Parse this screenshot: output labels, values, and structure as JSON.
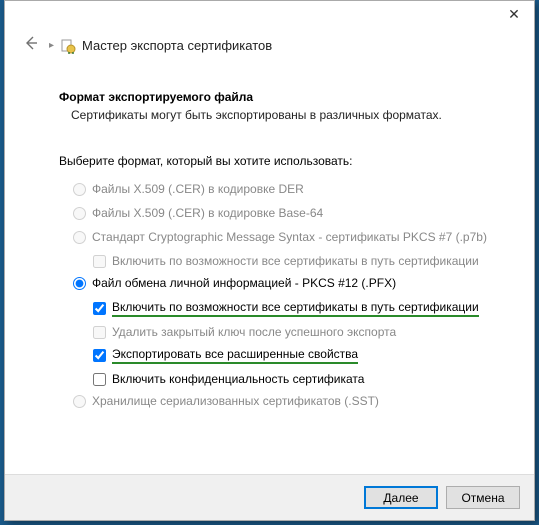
{
  "window": {
    "close_glyph": "✕"
  },
  "header": {
    "title": "Мастер экспорта сертификатов"
  },
  "section": {
    "title": "Формат экспортируемого файла",
    "subtitle": "Сертификаты могут быть экспортированы в различных форматах."
  },
  "instruction": "Выберите формат, который вы хотите использовать:",
  "options": {
    "der": "Файлы X.509 (.CER) в кодировке DER",
    "base64": "Файлы X.509 (.CER) в кодировке Base-64",
    "pkcs7": "Стандарт Cryptographic Message Syntax - сертификаты PKCS #7 (.p7b)",
    "pkcs7_sub": "Включить по возможности все сертификаты в путь сертификации",
    "pfx": "Файл обмена личной информацией - PKCS #12 (.PFX)",
    "pfx_chain": "Включить по возможности все сертификаты в путь сертификации",
    "pfx_delete": "Удалить закрытый ключ после успешного экспорта",
    "pfx_extprops": "Экспортировать все расширенные свойства",
    "pfx_privacy": "Включить конфиденциальность сертификата",
    "sst": "Хранилище сериализованных сертификатов (.SST)"
  },
  "footer": {
    "next": "Далее",
    "cancel": "Отмена"
  }
}
